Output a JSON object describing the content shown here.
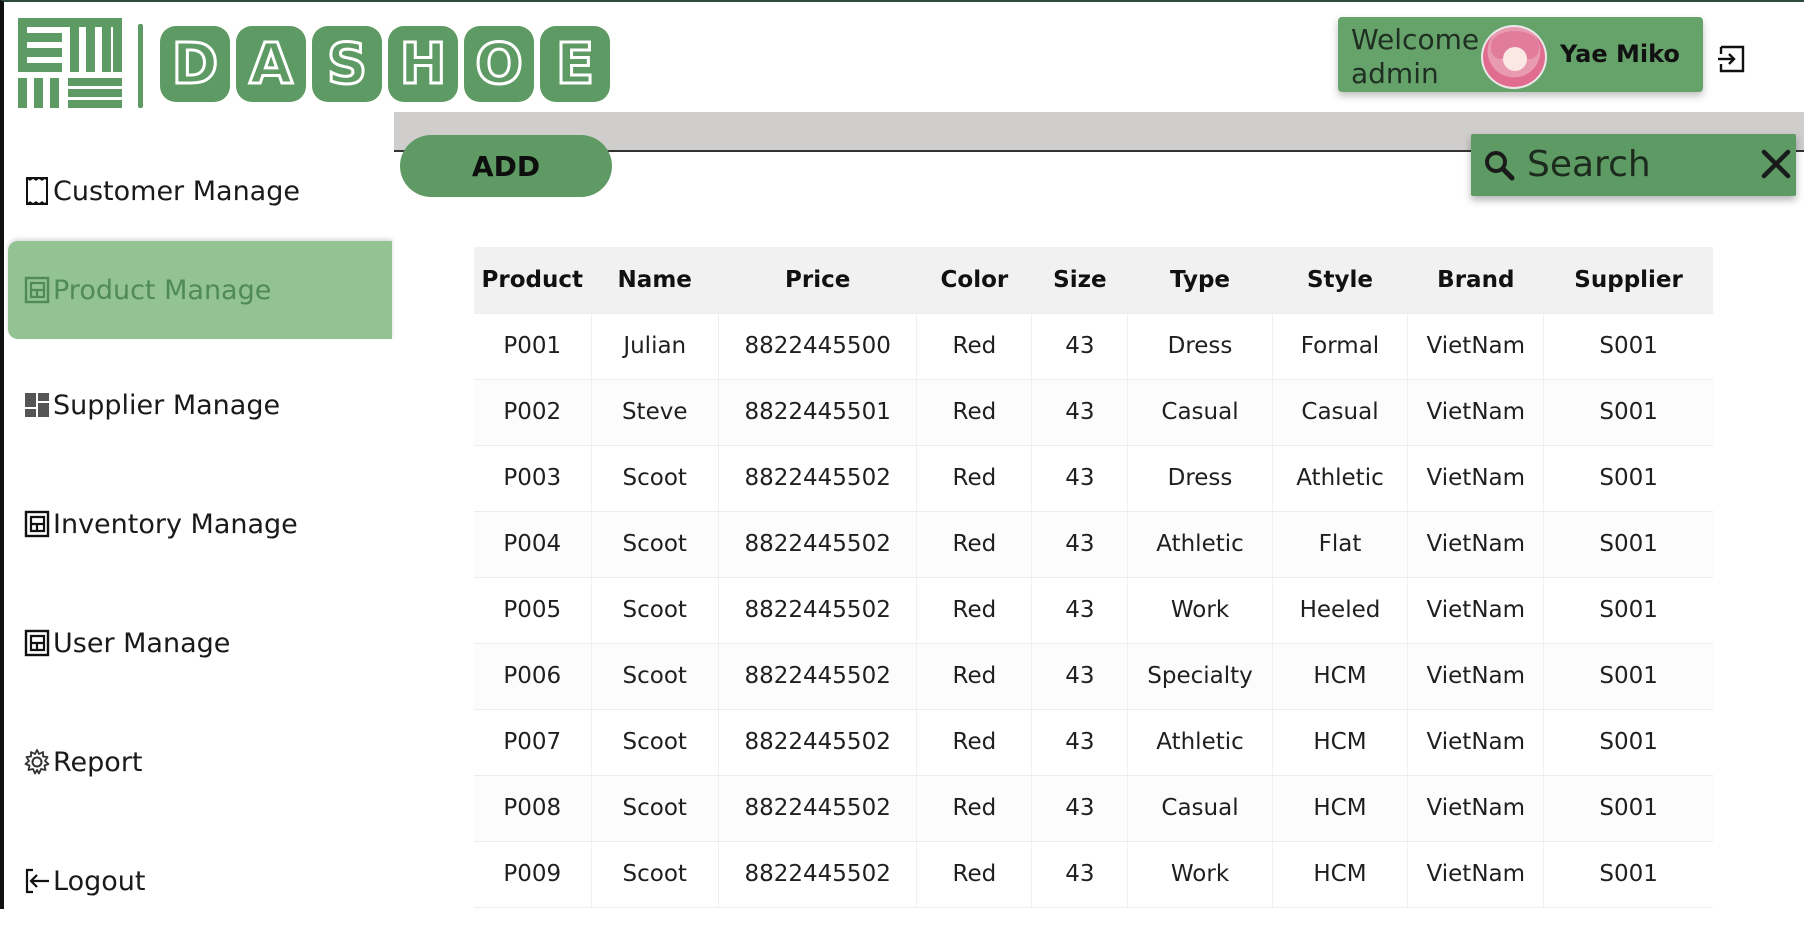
{
  "brand": {
    "letters": [
      "D",
      "A",
      "S",
      "H",
      "O",
      "E"
    ],
    "accent": "#5e9a64"
  },
  "header": {
    "welcome": "Welcome admin",
    "user_name": "Yae Miko",
    "logout_icon": "logout-arrow-icon"
  },
  "sidebar": {
    "items": [
      {
        "label": "Customer Manage",
        "icon": "receipt-icon",
        "active": false
      },
      {
        "label": "Product Manage",
        "icon": "layout-icon",
        "active": true
      },
      {
        "label": "Supplier Manage",
        "icon": "grid-icon",
        "active": false
      },
      {
        "label": "Inventory Manage",
        "icon": "layout-icon",
        "active": false
      },
      {
        "label": "User Manage",
        "icon": "layout-icon",
        "active": false
      },
      {
        "label": "Report",
        "icon": "gear-icon",
        "active": false
      },
      {
        "label": "Logout",
        "icon": "logout-icon",
        "active": false
      }
    ],
    "active_color": "#93c293"
  },
  "toolbar": {
    "add_label": "ADD",
    "search_placeholder": "Search"
  },
  "table": {
    "columns": [
      "Product",
      "Name",
      "Price",
      "Color",
      "Size",
      "Type",
      "Style",
      "Brand",
      "Supplier"
    ],
    "rows": [
      [
        "P001",
        "Julian",
        "8822445500",
        "Red",
        "43",
        "Dress",
        "Formal",
        "VietNam",
        "S001"
      ],
      [
        "P002",
        "Steve",
        "8822445501",
        "Red",
        "43",
        "Casual",
        "Casual",
        "VietNam",
        "S001"
      ],
      [
        "P003",
        "Scoot",
        "8822445502",
        "Red",
        "43",
        "Dress",
        "Athletic",
        "VietNam",
        "S001"
      ],
      [
        "P004",
        "Scoot",
        "8822445502",
        "Red",
        "43",
        "Athletic",
        "Flat",
        "VietNam",
        "S001"
      ],
      [
        "P005",
        "Scoot",
        "8822445502",
        "Red",
        "43",
        "Work",
        "Heeled",
        "VietNam",
        "S001"
      ],
      [
        "P006",
        "Scoot",
        "8822445502",
        "Red",
        "43",
        "Specialty",
        "HCM",
        "VietNam",
        "S001"
      ],
      [
        "P007",
        "Scoot",
        "8822445502",
        "Red",
        "43",
        "Athletic",
        "HCM",
        "VietNam",
        "S001"
      ],
      [
        "P008",
        "Scoot",
        "8822445502",
        "Red",
        "43",
        "Casual",
        "HCM",
        "VietNam",
        "S001"
      ],
      [
        "P009",
        "Scoot",
        "8822445502",
        "Red",
        "43",
        "Work",
        "HCM",
        "VietNam",
        "S001"
      ]
    ]
  }
}
